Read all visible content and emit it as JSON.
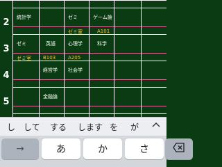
{
  "timetable": {
    "periods": [
      "2",
      "3",
      "4",
      "5"
    ],
    "cells": [
      {
        "id": "p2-c1",
        "title": "統計学",
        "room": ""
      },
      {
        "id": "p2-c3",
        "title": "ゼミ",
        "room": "ゼミ室"
      },
      {
        "id": "p2-c4",
        "title": "ゲーム論",
        "room": "A101"
      },
      {
        "id": "p3-c1",
        "title": "ゼミ",
        "room": "ゼミ室"
      },
      {
        "id": "p3-c2",
        "title": "英語",
        "room": "B103"
      },
      {
        "id": "p3-c3",
        "title": "心理学",
        "room": "A205"
      },
      {
        "id": "p3-c4",
        "title": "科学",
        "room": ""
      },
      {
        "id": "p4-c2",
        "title": "経営学",
        "room": ""
      },
      {
        "id": "p4-c3",
        "title": "社会学",
        "room": ""
      },
      {
        "id": "p5-c2",
        "title": "金融論",
        "room": ""
      }
    ]
  },
  "keyboard": {
    "suggestions": [
      "し",
      "して",
      "する",
      "します",
      "を",
      "が"
    ],
    "keys": {
      "next_arrow": "→",
      "a": "あ",
      "ka": "か",
      "sa": "さ"
    }
  },
  "colors": {
    "board": "#0b3b12",
    "room_text": "#e8c64a",
    "pink_line": "#e06a9a"
  }
}
